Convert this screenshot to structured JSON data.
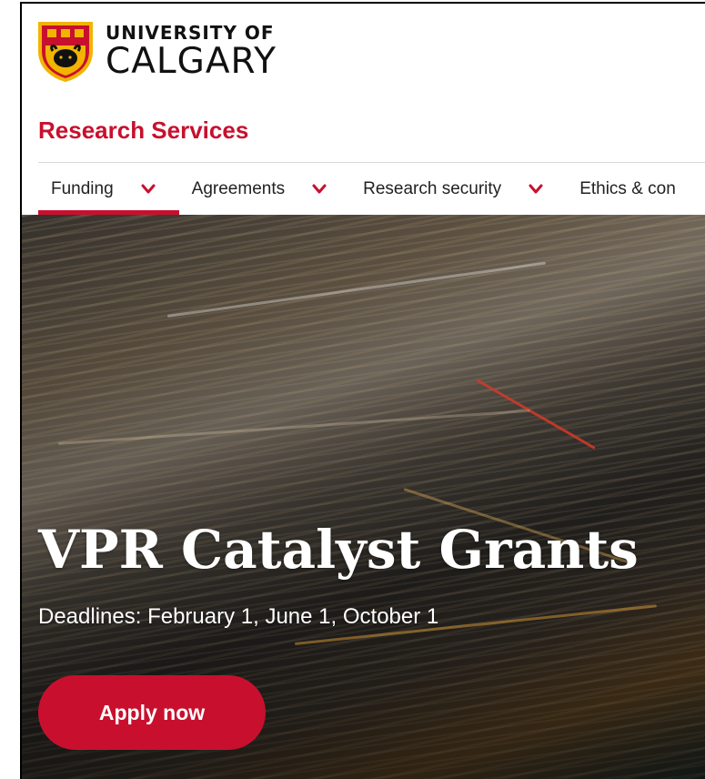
{
  "brand": {
    "line1": "UNIVERSITY OF",
    "line2": "CALGARY",
    "accent_color": "#c8102e",
    "crest_colors": [
      "#c8102e",
      "#f2b400",
      "#111111"
    ]
  },
  "site": {
    "title": "Research Services"
  },
  "nav": {
    "items": [
      {
        "label": "Funding",
        "icon": "chevron-down-icon",
        "active": true
      },
      {
        "label": "Agreements",
        "icon": "chevron-down-icon",
        "active": false
      },
      {
        "label": "Research security",
        "icon": "chevron-down-icon",
        "active": false
      },
      {
        "label": "Ethics & con",
        "icon": "",
        "active": false
      }
    ]
  },
  "hero": {
    "title": "VPR Catalyst Grants",
    "subtitle": "Deadlines: February 1, June 1, October 1",
    "cta_label": "Apply now"
  }
}
